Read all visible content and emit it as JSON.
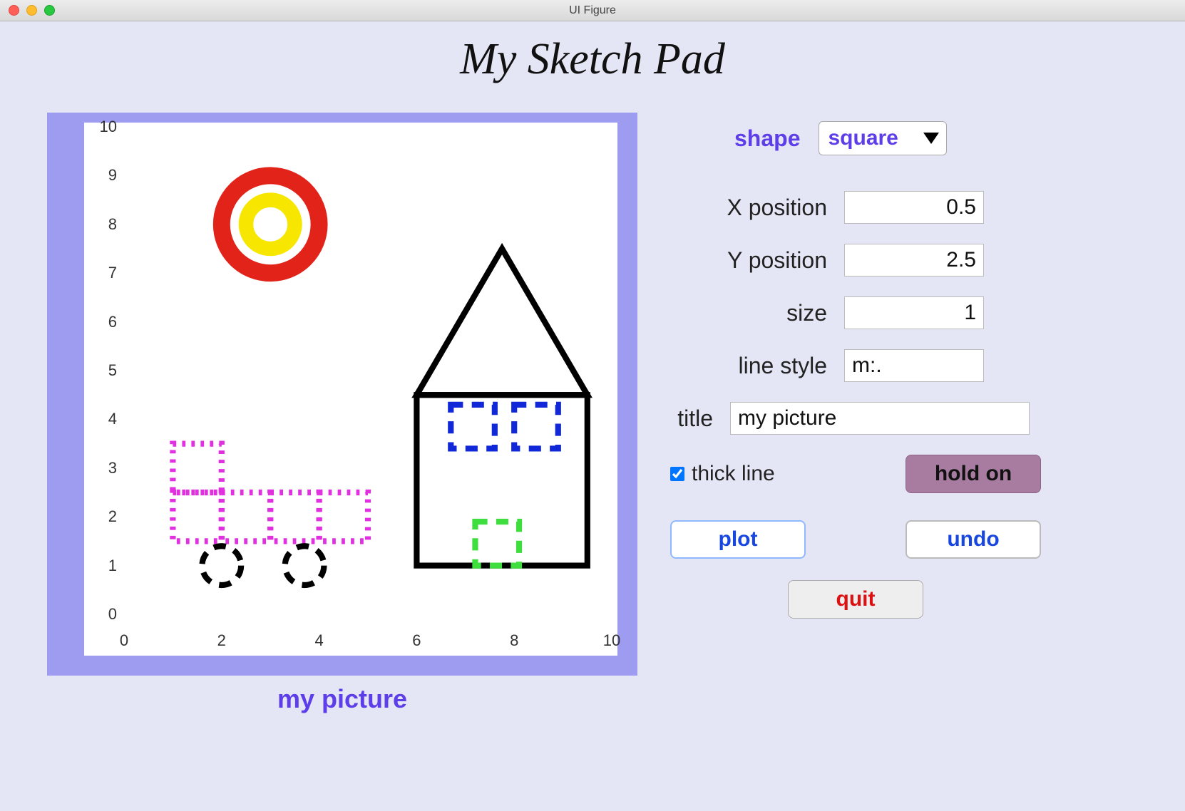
{
  "window": {
    "title": "UI Figure"
  },
  "app_title": "My Sketch Pad",
  "controls": {
    "shape_label": "shape",
    "shape_value": "square",
    "x_label": "X position",
    "x_value": "0.5",
    "y_label": "Y position",
    "y_value": "2.5",
    "size_label": "size",
    "size_value": "1",
    "linestyle_label": "line style",
    "linestyle_value": "m:.",
    "title_label": "title",
    "title_value": "my picture",
    "thick_label": "thick line",
    "thick_checked": true,
    "hold_label": "hold on",
    "plot_label": "plot",
    "undo_label": "undo",
    "quit_label": "quit"
  },
  "canvas": {
    "title": "my picture"
  },
  "colors": {
    "accent": "#5e3ee8",
    "canvas_violet": "#9d9cf1",
    "hold_button": "#a87ca0",
    "quit_text": "#d11",
    "link_blue": "#1746e0"
  },
  "chart_data": {
    "type": "scatter",
    "title": "my picture",
    "xlabel": "",
    "ylabel": "",
    "xlim": [
      0,
      10
    ],
    "ylim": [
      0,
      10
    ],
    "xticks": [
      0,
      2,
      4,
      6,
      8,
      10
    ],
    "yticks": [
      0,
      1,
      2,
      3,
      4,
      5,
      6,
      7,
      8,
      9,
      10
    ],
    "shapes": [
      {
        "kind": "square",
        "x": 6,
        "y": 1,
        "size": 3.5,
        "style": "k-",
        "thick": true,
        "note": "house body"
      },
      {
        "kind": "triangle",
        "pts": [
          [
            6,
            4.5
          ],
          [
            9.5,
            4.5
          ],
          [
            7.75,
            7.5
          ]
        ],
        "style": "k-",
        "thick": true,
        "note": "roof"
      },
      {
        "kind": "square",
        "x": 6.7,
        "y": 3.4,
        "size": 0.9,
        "style": "b--",
        "thick": true,
        "note": "left window"
      },
      {
        "kind": "square",
        "x": 8.0,
        "y": 3.4,
        "size": 0.9,
        "style": "b--",
        "thick": true,
        "note": "right window"
      },
      {
        "kind": "square",
        "x": 7.2,
        "y": 1.0,
        "size": 0.9,
        "style": "g--",
        "thick": true,
        "note": "door"
      },
      {
        "kind": "circle",
        "cx": 3.0,
        "cy": 8.0,
        "r": 1.0,
        "style": "r-",
        "thick": true,
        "note": "sun outer"
      },
      {
        "kind": "circle",
        "cx": 3.0,
        "cy": 8.0,
        "r": 0.5,
        "style": "y-",
        "thick": true,
        "note": "sun inner"
      },
      {
        "kind": "square",
        "x": 1.0,
        "y": 1.5,
        "size": 1.0,
        "style": "m:.",
        "thick": true,
        "note": "truck bed 1"
      },
      {
        "kind": "square",
        "x": 2.0,
        "y": 1.5,
        "size": 1.0,
        "style": "m:.",
        "thick": true,
        "note": "truck bed 2"
      },
      {
        "kind": "square",
        "x": 3.0,
        "y": 1.5,
        "size": 1.0,
        "style": "m:.",
        "thick": true,
        "note": "truck bed 3"
      },
      {
        "kind": "square",
        "x": 4.0,
        "y": 1.5,
        "size": 1.0,
        "style": "m:.",
        "thick": true,
        "note": "truck bed 4"
      },
      {
        "kind": "square",
        "x": 1.0,
        "y": 2.5,
        "size": 1.0,
        "style": "m:.",
        "thick": true,
        "note": "truck cab"
      },
      {
        "kind": "circle",
        "cx": 2.0,
        "cy": 1.0,
        "r": 0.4,
        "style": "k--",
        "thick": true,
        "note": "wheel 1"
      },
      {
        "kind": "circle",
        "cx": 3.7,
        "cy": 1.0,
        "r": 0.4,
        "style": "k--",
        "thick": true,
        "note": "wheel 2"
      }
    ]
  }
}
